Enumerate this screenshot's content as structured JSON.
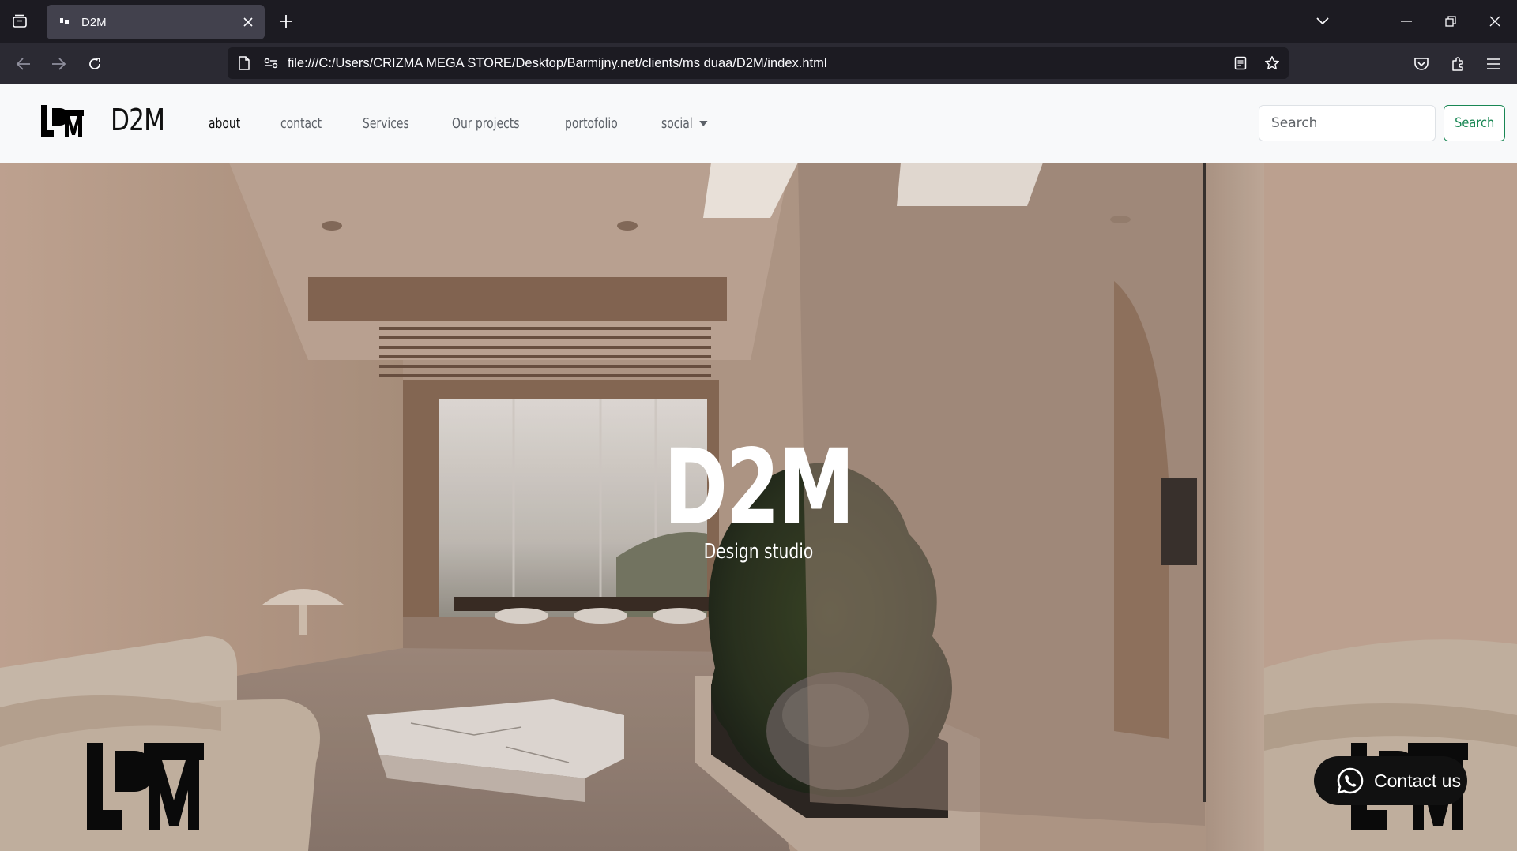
{
  "browser": {
    "tab_title": "D2M",
    "url": "file:///C:/Users/CRIZMA MEGA STORE/Desktop/Barmijny.net/clients/ms duaa/D2M/index.html",
    "icons": [
      "tab-list-icon",
      "close-icon",
      "plus-icon",
      "chevron-down-icon",
      "minimize-icon",
      "restore-icon",
      "close-window-icon",
      "back-arrow-icon",
      "forward-arrow-icon",
      "reload-icon",
      "page-icon",
      "permissions-icon",
      "reader-view-icon",
      "star-icon",
      "pocket-icon",
      "extensions-icon",
      "menu-icon"
    ]
  },
  "site": {
    "brand": "D2M",
    "menu": [
      {
        "label": "about",
        "active": true
      },
      {
        "label": "contact"
      },
      {
        "label": "Services"
      },
      {
        "label": "Our projects"
      },
      {
        "label": "portofolio"
      },
      {
        "label": "social",
        "dropdown": true
      }
    ],
    "search": {
      "placeholder": "Search",
      "button": "Search"
    },
    "hero": {
      "title": "D2M",
      "subtitle": "Design studio"
    },
    "contact_button": "Contact us"
  },
  "colors": {
    "browser_dark": "#1c1b22",
    "toolbar": "#2b2a33",
    "navbar_bg": "#f8f9fa",
    "success": "#198754",
    "hero_text": "#ffffff"
  }
}
